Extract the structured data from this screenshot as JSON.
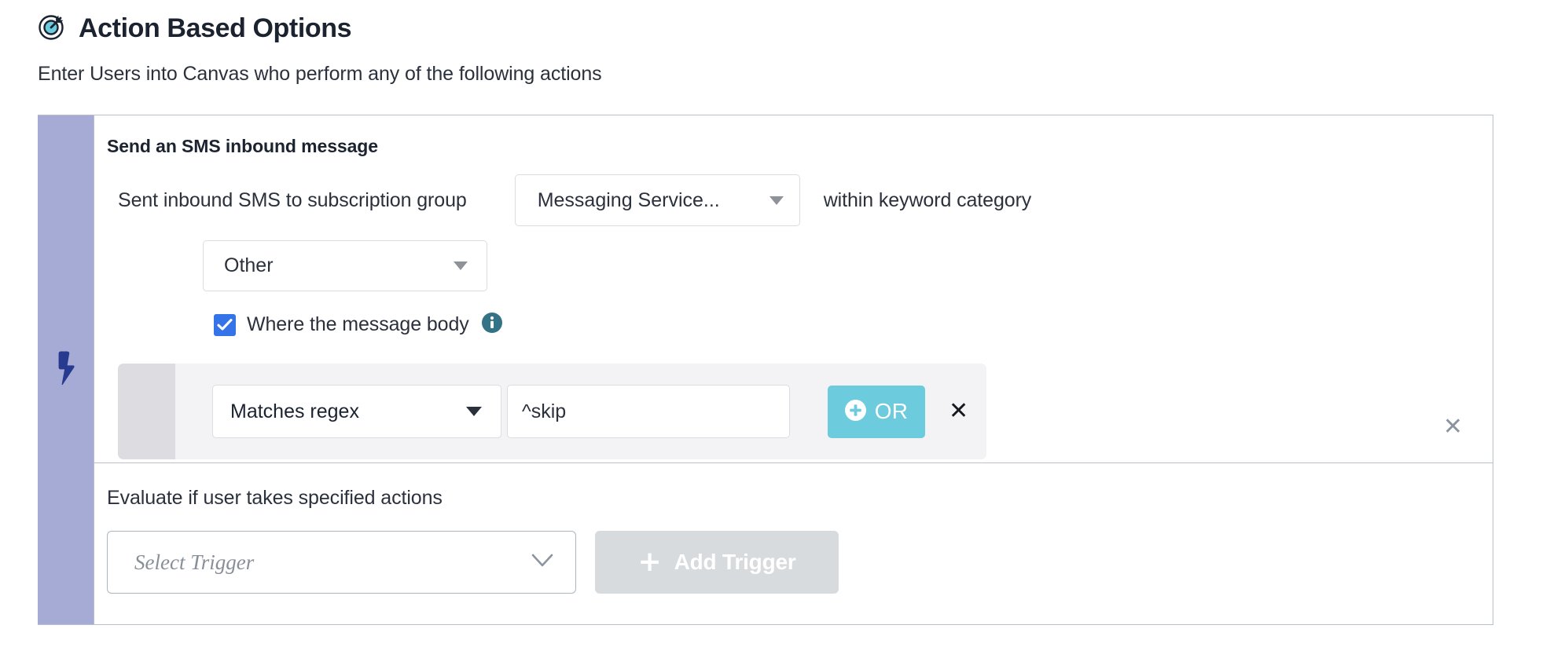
{
  "header": {
    "icon": "target-icon",
    "title": "Action Based Options",
    "accent_teal": "#6ccbdd",
    "title_color": "#1c2330"
  },
  "subtitle": "Enter Users into Canvas who perform any of the following actions",
  "card": {
    "rail": {
      "icon": "lightning-bolt-icon",
      "background": "#a5abd4",
      "icon_color": "#273a8f"
    },
    "border_color": "#b9c0cb",
    "trigger_title": "Send an SMS inbound message",
    "subscription_row": {
      "label": "Sent inbound SMS to subscription group",
      "messaging_service_dropdown": {
        "value": "Messaging Service...",
        "icon": "caret-down-icon"
      },
      "suffix_label": "within keyword category"
    },
    "group_dropdown": {
      "value": "Other",
      "icon": "caret-down-icon"
    },
    "message_body_checkbox": {
      "checked": true,
      "label": "Where the message body",
      "checkbox_color": "#3473e8",
      "info_icon": "info-icon",
      "info_icon_color": "#347286"
    },
    "remove_trigger_icon": "close-icon",
    "filter_row": {
      "handle_icon": "drag-handle",
      "operator_dropdown": {
        "value": "Matches regex",
        "icon": "caret-down-icon"
      },
      "value_input": {
        "value": "^skip",
        "placeholder": ""
      },
      "or_button": {
        "label": "OR",
        "icon": "plus-circle-icon",
        "color": "#6ccbdd"
      },
      "remove_icon": "close-icon",
      "background": "#f3f3f5",
      "handle_background": "#dcdce1"
    },
    "lower": {
      "label": "Evaluate if user takes specified actions",
      "select_trigger": {
        "placeholder": "Select Trigger",
        "value": "",
        "icon": "chevron-down-icon"
      },
      "add_trigger_button": {
        "label": "Add Trigger",
        "icon": "plus-icon",
        "disabled": true,
        "background": "#d8dbde"
      }
    }
  }
}
